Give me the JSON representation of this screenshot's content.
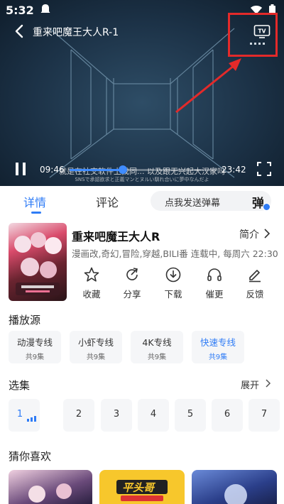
{
  "status_bar": {
    "time": "5:32"
  },
  "player": {
    "title": "重来吧魔王大人R-1",
    "subtitle_line1": "就是在社交软件上找同... 以及跟无兴起大汉家吗",
    "subtitle_line2": "SNSで承認欲求と正義マンとヌルい馴れ合いに夢中なんだよ",
    "current_time": "09:46",
    "total_time": "23:42",
    "progress_fraction": 0.36,
    "cast_badge": "TV"
  },
  "tabs": {
    "detail": "详情",
    "comment": "评论"
  },
  "danmaku": {
    "placeholder": "点我发送弹幕",
    "button": "弹"
  },
  "anime": {
    "title": "重来吧魔王大人R",
    "intro_label": "简介",
    "meta": "漫画改,奇幻,冒险,穿越,BILI番 连载中, 每周六 22:30 更新"
  },
  "actions": [
    {
      "label": "收藏",
      "icon": "star-icon"
    },
    {
      "label": "分享",
      "icon": "share-icon"
    },
    {
      "label": "下载",
      "icon": "download-icon"
    },
    {
      "label": "催更",
      "icon": "headphones-icon"
    },
    {
      "label": "反馈",
      "icon": "pencil-icon"
    }
  ],
  "sources_title": "播放源",
  "sources": [
    {
      "name": "动漫专线",
      "count": "共9集"
    },
    {
      "name": "小虾专线",
      "count": "共9集"
    },
    {
      "name": "4K专线",
      "count": "共9集"
    },
    {
      "name": "快速专线",
      "count": "共9集"
    }
  ],
  "episodes_title": "选集",
  "expand_label": "展开",
  "episodes": [
    "1",
    "2",
    "3",
    "4",
    "5",
    "6",
    "7"
  ],
  "recommend_title": "猜你喜欢",
  "recommend_badge": "平头哥",
  "colors": {
    "accent": "#2f7cf6",
    "highlight_box": "#e32a2a"
  }
}
